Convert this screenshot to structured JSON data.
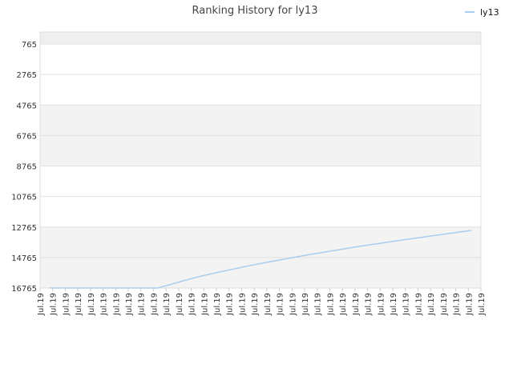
{
  "chart_data": {
    "type": "line",
    "title": "Ranking History for ly13",
    "xlabel": "",
    "ylabel": "",
    "y_reversed": true,
    "ylim": [
      765,
      16765
    ],
    "y_ticks": [
      765,
      2765,
      4765,
      6765,
      8765,
      10765,
      12765,
      14765,
      16765
    ],
    "x_tick_labels": [
      "Jul.19",
      "Jul.19",
      "Jul.19",
      "Jul.19",
      "Jul.19",
      "Jul.19",
      "Jul.19",
      "Jul.19",
      "Jul.19",
      "Jul.19",
      "Jul.19",
      "Jul.19",
      "Jul.19",
      "Jul.19",
      "Jul.19",
      "Jul.19",
      "Jul.19",
      "Jul.19",
      "Jul.19",
      "Jul.19",
      "Jul.19",
      "Jul.19",
      "Jul.19",
      "Jul.19",
      "Jul.19",
      "Jul.19",
      "Jul.19",
      "Jul.19",
      "Jul.19",
      "Jul.19",
      "Jul.19",
      "Jul.19",
      "Jul.19",
      "Jul.19",
      "Jul.19",
      "Jul.19"
    ],
    "grid": true,
    "legend_position": "top-right",
    "series": [
      {
        "name": "ly13",
        "color": "#a8cdf0",
        "values": [
          16765,
          16765,
          16765,
          16765,
          16765,
          16765,
          16765,
          16765,
          16765,
          16765,
          16765,
          16565,
          16365,
          16165,
          15990,
          15830,
          15670,
          15520,
          15370,
          15230,
          15090,
          14960,
          14830,
          14705,
          14580,
          14460,
          14340,
          14225,
          14110,
          14000,
          13890,
          13785,
          13680,
          13580,
          13480,
          13380,
          13280,
          13185,
          13090,
          12990
        ]
      }
    ]
  }
}
